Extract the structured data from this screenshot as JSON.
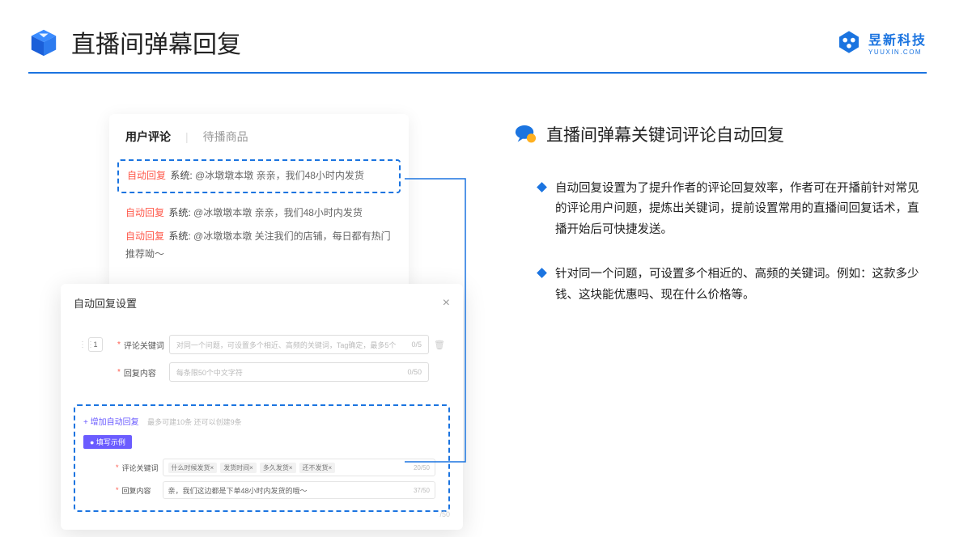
{
  "header": {
    "title": "直播间弹幕回复",
    "brand_name": "昱新科技",
    "brand_sub": "YUUXIN.COM"
  },
  "comment_panel": {
    "tab_active": "用户评论",
    "tab_inactive": "待播商品",
    "rows": [
      {
        "tag": "自动回复",
        "prefix": "系统:",
        "text": "@冰墩墩本墩 亲亲，我们48小时内发货"
      },
      {
        "tag": "自动回复",
        "prefix": "系统:",
        "text": "@冰墩墩本墩 亲亲，我们48小时内发货"
      },
      {
        "tag": "自动回复",
        "prefix": "系统:",
        "text": "@冰墩墩本墩 关注我们的店铺，每日都有热门推荐呦～"
      }
    ]
  },
  "modal": {
    "title": "自动回复设置",
    "index": "1",
    "label_keyword": "评论关键词",
    "placeholder_keyword": "对同一个问题，可设置多个相近、高频的关键词，Tag确定，最多5个",
    "count_keyword": "0/5",
    "label_content": "回复内容",
    "placeholder_content": "每条限50个中文字符",
    "count_content": "0/50",
    "add_link": "+ 增加自动回复",
    "add_note": "最多可建10条 还可以创建9条",
    "example_badge": "● 填写示例",
    "ex_label_keyword": "评论关键词",
    "ex_tags": [
      "什么时候发货×",
      "发货时间×",
      "多久发货×",
      "还不发货×"
    ],
    "ex_count_keyword": "20/50",
    "ex_label_content": "回复内容",
    "ex_content_value": "亲，我们这边都是下单48小时内发货的哦～",
    "ex_count_content": "37/50",
    "scroll_hint": "/50"
  },
  "right": {
    "section_title": "直播间弹幕关键词评论自动回复",
    "bullets": [
      "自动回复设置为了提升作者的评论回复效率，作者可在开播前针对常见的评论用户问题，提炼出关键词，提前设置常用的直播间回复话术，直播开始后可快捷发送。",
      "针对同一个问题，可设置多个相近的、高频的关键词。例如：这款多少钱、这块能优惠吗、现在什么价格等。"
    ]
  }
}
